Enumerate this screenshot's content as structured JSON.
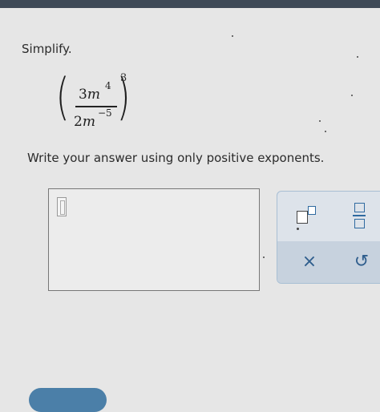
{
  "problem": {
    "prompt": "Simplify.",
    "expression": {
      "numerator_coef": "3",
      "numerator_var": "m",
      "numerator_exp": "4",
      "denominator_coef": "2",
      "denominator_var": "m",
      "denominator_exp": "−5",
      "outer_exp": "3"
    },
    "instruction": "Write your answer using only positive exponents."
  },
  "answer": {
    "value": ""
  },
  "toolbar": {
    "exponent_icon": "exponent-template-icon",
    "fraction_icon": "fraction-template-icon",
    "clear_label": "×",
    "undo_label": "↺"
  },
  "colors": {
    "accent": "#2f5e8d",
    "panel": "#dde3ea",
    "panel_lower": "#c7d2de",
    "button": "#4b7fa8"
  }
}
